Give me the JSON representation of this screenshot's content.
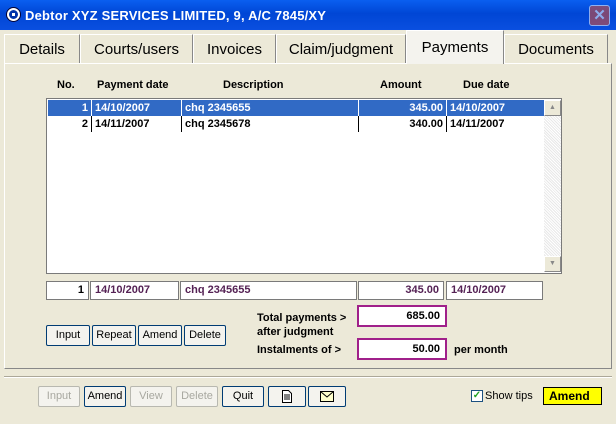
{
  "window": {
    "title": "Debtor XYZ SERVICES LIMITED, 9,  A/C  7845/XY",
    "close_glyph": "✕"
  },
  "tabs": [
    {
      "label": "Details",
      "active": false
    },
    {
      "label": "Courts/users",
      "active": false
    },
    {
      "label": "Invoices",
      "active": false
    },
    {
      "label": "Claim/judgment",
      "active": false
    },
    {
      "label": "Payments",
      "active": true
    },
    {
      "label": "Documents",
      "active": false
    }
  ],
  "columns": {
    "no": "No.",
    "date": "Payment date",
    "desc": "Description",
    "amount": "Amount",
    "due": "Due date"
  },
  "rows": [
    {
      "no": "1",
      "date": "14/10/2007",
      "desc": "chq 2345655",
      "amount": "345.00",
      "due": "14/10/2007",
      "selected": true
    },
    {
      "no": "2",
      "date": "14/11/2007",
      "desc": "chq 2345678",
      "amount": "340.00",
      "due": "14/11/2007",
      "selected": false
    }
  ],
  "edit_row": {
    "no": "1",
    "date": "14/10/2007",
    "desc": "chq 2345655",
    "amount": "345.00",
    "due": "14/10/2007"
  },
  "row_buttons": {
    "input": "Input",
    "repeat": "Repeat",
    "amend": "Amend",
    "delete": "Delete"
  },
  "totals": {
    "label1": "Total payments  >",
    "label2": "after judgment",
    "total": "685.00",
    "instal_label": "Instalments of  >",
    "instal_value": "50.00",
    "per_month": "per month"
  },
  "bottom_buttons": {
    "input": "Input",
    "amend": "Amend",
    "view": "View",
    "delete": "Delete",
    "quit": "Quit"
  },
  "show_tips": {
    "label": "Show tips",
    "checked": true
  },
  "mode_badge": "Amend",
  "colors": {
    "title_blue": "#0046d5",
    "selection": "#316ac5",
    "badge": "#ffff00",
    "highlight_border": "#a0208a"
  }
}
